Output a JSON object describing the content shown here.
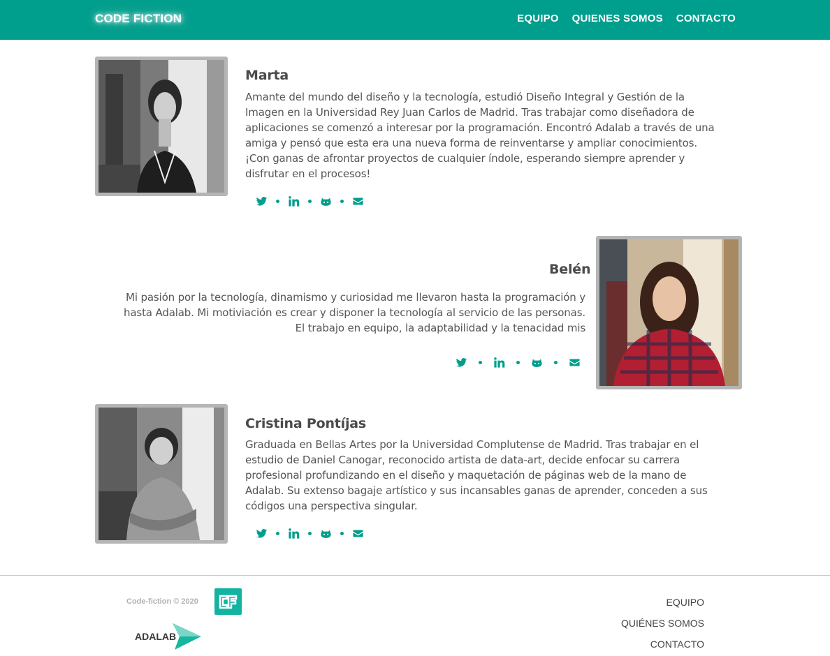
{
  "header": {
    "brand": "CODE FICTION",
    "nav": [
      "EQUIPO",
      "QUIENES SOMOS",
      "CONTACTO"
    ]
  },
  "profiles": [
    {
      "name": "Marta",
      "bio": "Amante del mundo del diseño y la tecnología, estudió Diseño Integral y Gestión de la Imagen en la Universidad Rey Juan Carlos de Madrid. Tras trabajar como diseñadora de aplicaciones se comenzó a interesar por la programación. Encontró Adalab a través de una amiga y pensó que esta era una nueva forma de reinventarse y ampliar conocimientos. ¡Con ganas de afrontar proyectos de cualquier índole, esperando siempre aprender y disfrutar en el procesos!",
      "photo": "black-and-white portrait"
    },
    {
      "name": "Belén",
      "bio": "Mi pasión por la tecnología, dinamismo y curiosidad me llevaron hasta la programación y hasta Adalab. Mi motiviación es crear y disponer la tecnología al servicio de las personas. El trabajo en equipo, la adaptabilidad y la tenacidad mis",
      "photo": "color portrait"
    },
    {
      "name": "Cristina Pontíjas",
      "bio": "Graduada en Bellas Artes por la Universidad Complutense de Madrid. Tras trabajar en el estudio de Daniel Canogar, reconocido artista de data-art, decide enfocar su carrera profesional profundizando en el diseño y maquetación de páginas web de la mano de Adalab. Su extenso bagaje artístico y sus incansables ganas de aprender, conceden a sus códigos una perspectiva singular.",
      "photo": "black-and-white portrait"
    }
  ],
  "social_icons": [
    "twitter-icon",
    "linkedin-icon",
    "github-icon",
    "mail-icon"
  ],
  "footer": {
    "copyright": "Code-fiction © 2020",
    "logo_text": "CF",
    "partner_logo": "ADALAB",
    "nav": [
      "EQUIPO",
      "QUIÉNES SOMOS",
      "CONTACTO"
    ]
  },
  "colors": {
    "accent": "#009e8c",
    "text": "#444444",
    "photo_border": "#b5b5b5"
  }
}
